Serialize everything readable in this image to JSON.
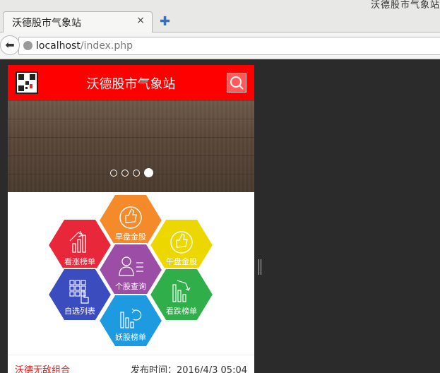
{
  "browser": {
    "top_right_text": "沃德股市气象站",
    "tab": {
      "title": "沃德股市气象站",
      "close": "×"
    },
    "new_tab": "✚",
    "back": "⬅",
    "url": {
      "host": "localhost",
      "path": "/index.php"
    }
  },
  "app": {
    "title": "沃德股市气象站",
    "carousel": {
      "count": 4,
      "active_index": 3
    },
    "menu": [
      {
        "label": "早盘金股",
        "color": "#f58a2a",
        "icon": "thumbs-up-icon"
      },
      {
        "label": "看涨榜单",
        "color": "#e8283a",
        "icon": "rising-chart-icon"
      },
      {
        "label": "午盘金股",
        "color": "#ecd800",
        "icon": "thumbs-up-icon"
      },
      {
        "label": "个股查询",
        "color": "#9c4ea6",
        "icon": "person-list-icon"
      },
      {
        "label": "自选列表",
        "color": "#3b4cbf",
        "icon": "keypad-hand-icon"
      },
      {
        "label": "看跌榜单",
        "color": "#2fae4a",
        "icon": "falling-chart-icon"
      },
      {
        "label": "妖股榜单",
        "color": "#1e9be0",
        "icon": "refresh-chart-icon"
      }
    ],
    "footer": {
      "left": "沃德无敌组合",
      "right": "发布时间：2016/4/3 05:04"
    }
  }
}
